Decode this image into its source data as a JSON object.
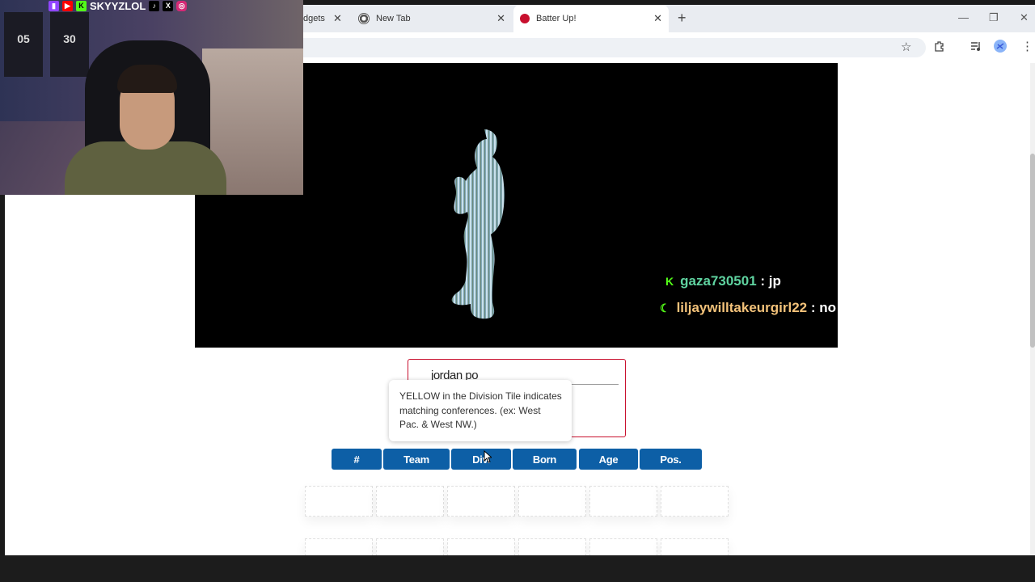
{
  "browser": {
    "tabs": [
      {
        "label": "dgets",
        "active": false
      },
      {
        "label": "New Tab",
        "active": false
      },
      {
        "label": "Batter Up!",
        "active": true
      }
    ],
    "close_glyph": "✕",
    "new_tab_glyph": "+",
    "window_controls": {
      "minimize": "—",
      "restore": "❐",
      "close": "✕"
    },
    "toolbar_icons": [
      "star-icon",
      "extensions-icon",
      "media-icon",
      "profile-icon",
      "menu-icon"
    ]
  },
  "stream": {
    "handle": "SKYYZLOL",
    "jerseys": [
      "05",
      "30"
    ],
    "chat": [
      {
        "user": "gaza730501",
        "message": "jp",
        "color": "#5fd3a0"
      },
      {
        "user": "liljaywilltakeurgirl22",
        "message": "no",
        "color": "#f3c27a"
      }
    ]
  },
  "game": {
    "guess_value": "jordan po",
    "tooltip": "YELLOW in the Division Tile indicates matching conferences. (ex: West Pac. & West NW.)",
    "columns": [
      "#",
      "Team",
      "Div.",
      "Born",
      "Age",
      "Pos."
    ],
    "accent_color": "#0d5fa6",
    "border_color": "#c8102e"
  }
}
